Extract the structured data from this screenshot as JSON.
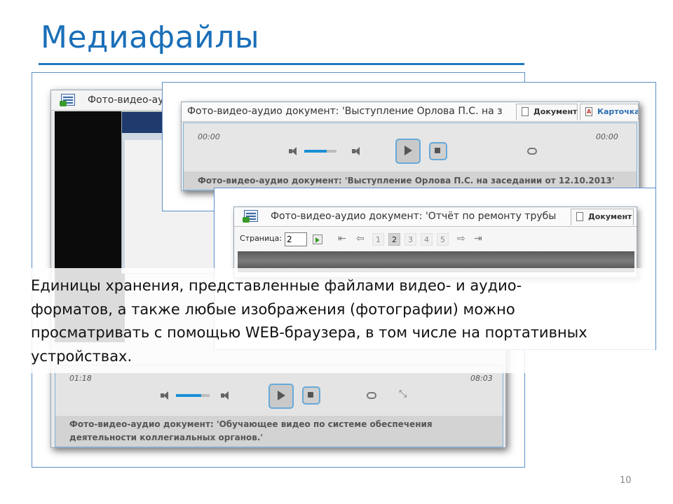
{
  "slide": {
    "title": "Медиафайлы",
    "page_number": "10",
    "body_text": "Единицы хранения, представленные файлами видео- и аудио-форматов, а также любые изображения (фотографии) можно просматривать с помощью WEB-браузера, в том числе на портативных устройствах."
  },
  "colors": {
    "title_blue": "#1a6fb8",
    "frame_blue": "#5b8fc7",
    "accent_blue": "#1a8fd6"
  },
  "window_back": {
    "title": "Фото-видео-ауд",
    "time_start": "01:18",
    "time_end": "08:03",
    "volume_level": 0.75,
    "caption_line1": "Фото-видео-аудио документ: 'Обучающее видео по системе обеспечения",
    "caption_line2": "деятельности коллегиальных органов.'"
  },
  "window_middle": {
    "title": "Фото-видео-аудио документ: 'Выступление Орлова П.С. на з",
    "tab_document": "Документ",
    "tab_card": "Карточка",
    "time_start": "00:00",
    "time_end": "00:00",
    "volume_level": 0.7,
    "caption": "Фото-видео-аудио документ: 'Выступление Орлова П.С. на заседании от 12.10.2013'"
  },
  "window_front": {
    "title": "Фото-видео-аудио документ: 'Отчёт по ремонту трубы",
    "tab_document": "Документ",
    "pager_label": "Страница:",
    "page_value": "2",
    "pages": [
      "1",
      "2",
      "3",
      "4",
      "5"
    ],
    "active_page": "2"
  }
}
